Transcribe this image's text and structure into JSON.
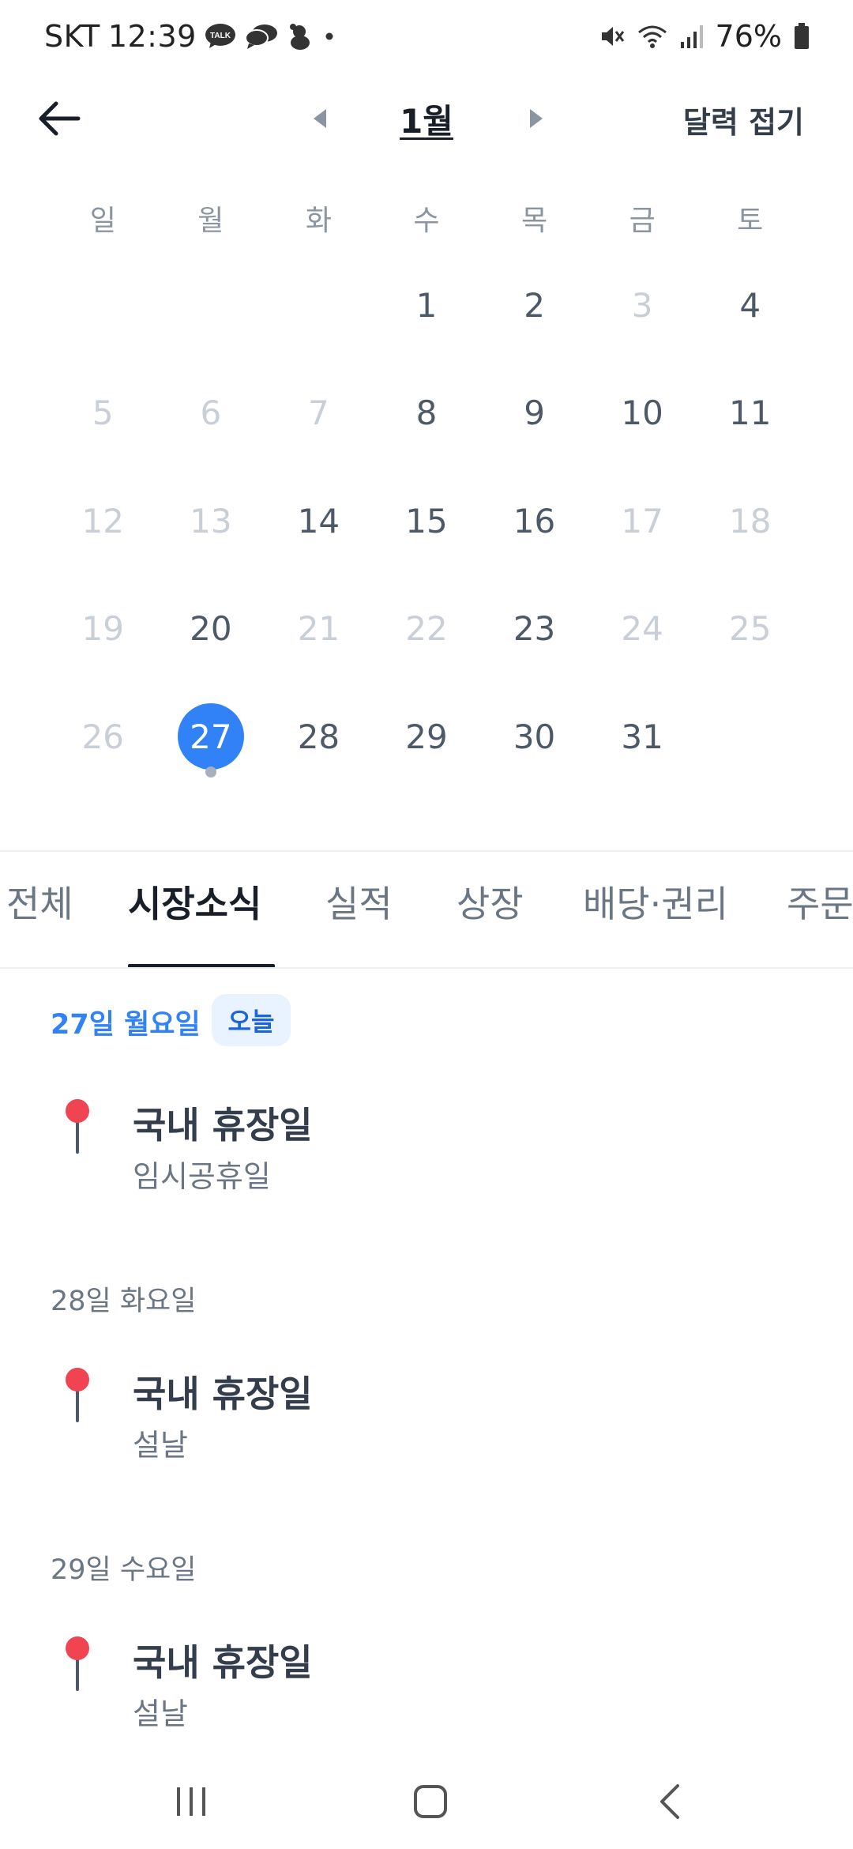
{
  "status_bar": {
    "carrier": "SKT",
    "time": "12:39",
    "talk_badge": "TALK",
    "battery": "76%"
  },
  "nav": {
    "month": "1월",
    "collapse_label": "달력 접기"
  },
  "calendar": {
    "weekdays": [
      "일",
      "월",
      "화",
      "수",
      "목",
      "금",
      "토"
    ],
    "weeks": [
      [
        null,
        null,
        null,
        {
          "d": "1",
          "muted": false
        },
        {
          "d": "2",
          "muted": false
        },
        {
          "d": "3",
          "muted": true
        },
        {
          "d": "4",
          "muted": false
        }
      ],
      [
        {
          "d": "5",
          "muted": true
        },
        {
          "d": "6",
          "muted": true
        },
        {
          "d": "7",
          "muted": true
        },
        {
          "d": "8",
          "muted": false
        },
        {
          "d": "9",
          "muted": false
        },
        {
          "d": "10",
          "muted": false
        },
        {
          "d": "11",
          "muted": false
        }
      ],
      [
        {
          "d": "12",
          "muted": true
        },
        {
          "d": "13",
          "muted": true
        },
        {
          "d": "14",
          "muted": false
        },
        {
          "d": "15",
          "muted": false
        },
        {
          "d": "16",
          "muted": false
        },
        {
          "d": "17",
          "muted": true
        },
        {
          "d": "18",
          "muted": true
        }
      ],
      [
        {
          "d": "19",
          "muted": true
        },
        {
          "d": "20",
          "muted": false
        },
        {
          "d": "21",
          "muted": true
        },
        {
          "d": "22",
          "muted": true
        },
        {
          "d": "23",
          "muted": false
        },
        {
          "d": "24",
          "muted": true
        },
        {
          "d": "25",
          "muted": true
        }
      ],
      [
        {
          "d": "26",
          "muted": true
        },
        {
          "d": "27",
          "muted": false,
          "selected": true,
          "dot": true
        },
        {
          "d": "28",
          "muted": false
        },
        {
          "d": "29",
          "muted": false
        },
        {
          "d": "30",
          "muted": false
        },
        {
          "d": "31",
          "muted": false
        },
        null
      ]
    ],
    "selected_color": "#3182f6"
  },
  "tabs": [
    {
      "label": "전체",
      "active": false
    },
    {
      "label": "시장소식",
      "active": true
    },
    {
      "label": "실적",
      "active": false
    },
    {
      "label": "상장",
      "active": false
    },
    {
      "label": "배당·권리",
      "active": false
    },
    {
      "label": "주문",
      "active": false
    }
  ],
  "events": {
    "today_badge": "오늘",
    "groups": [
      {
        "date": "27일 월요일",
        "title": "국내 휴장일",
        "sub": "임시공휴일"
      },
      {
        "date": "28일 화요일",
        "title": "국내 휴장일",
        "sub": "설날"
      },
      {
        "date": "29일 수요일",
        "title": "국내 휴장일",
        "sub": "설날"
      }
    ],
    "pin_color": "#f04452"
  }
}
